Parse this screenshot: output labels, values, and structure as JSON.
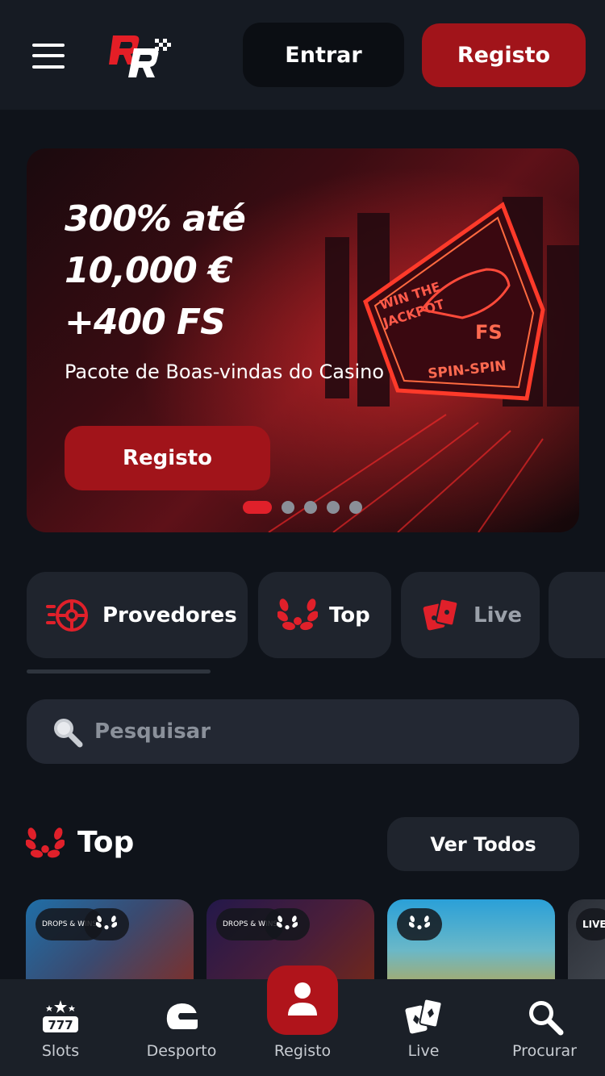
{
  "header": {
    "login_label": "Entrar",
    "register_label": "Registo",
    "logo_text": "RR"
  },
  "banner": {
    "title_line1": "300% até",
    "title_line2": "10,000 €",
    "title_line3": "+400 FS",
    "subtitle": "Pacote de Boas-vindas do Casino",
    "cta_label": "Registo",
    "art_text": {
      "sign_line1": "WIN THE",
      "sign_line2": "JACKPOT",
      "sign_fs": "FS",
      "sign_spin": "SPIN-SPIN"
    },
    "slides_total": 5,
    "active_slide": 1
  },
  "categories": [
    {
      "label": "Provedores",
      "icon": "wheel-icon"
    },
    {
      "label": "Top",
      "icon": "laurel-icon"
    },
    {
      "label": "Live",
      "icon": "cards-icon"
    }
  ],
  "search": {
    "placeholder": "Pesquisar"
  },
  "top_section": {
    "title": "Top",
    "see_all_label": "Ver Todos"
  },
  "games": [
    {
      "badges": [
        "DROPS & WINS",
        "laurel"
      ],
      "colors": [
        "#1f6fa8",
        "#8b2a1c"
      ]
    },
    {
      "badges": [
        "DROPS & WINS",
        "laurel"
      ],
      "colors": [
        "#23184a",
        "#7a2a14"
      ]
    },
    {
      "badges": [
        "laurel"
      ],
      "colors": [
        "#2aa0d8",
        "#d8a020"
      ]
    },
    {
      "badges": [
        "LIVE"
      ],
      "colors": [
        "#2a2e36",
        "#454a52"
      ]
    }
  ],
  "bottom_nav": [
    {
      "label": "Slots",
      "icon": "slots-777-icon"
    },
    {
      "label": "Desporto",
      "icon": "helmet-icon"
    },
    {
      "label": "Registo",
      "icon": "user-icon"
    },
    {
      "label": "Live",
      "icon": "cards-icon"
    },
    {
      "label": "Procurar",
      "icon": "search-icon"
    }
  ],
  "colors": {
    "background": "#0f131a",
    "header": "#161b23",
    "accent_red": "#a1141a",
    "chip": "#1f242d"
  }
}
